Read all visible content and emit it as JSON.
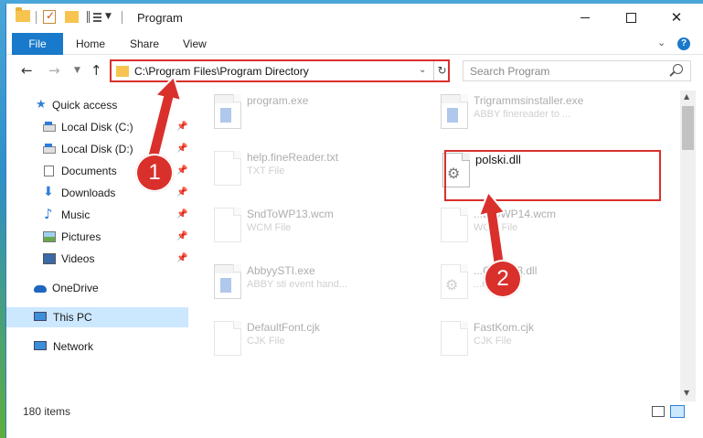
{
  "window": {
    "title": "Program",
    "controls": {
      "minimize": "",
      "maximize": "",
      "close": "✕"
    }
  },
  "ribbon": {
    "tabs": [
      "File",
      "Home",
      "Share",
      "View"
    ],
    "help": "?"
  },
  "address": {
    "path": "C:\\Program Files\\Program Directory"
  },
  "search": {
    "placeholder": "Search Program"
  },
  "sidebar": {
    "items": [
      {
        "label": "Quick access",
        "icon": "star-icon"
      },
      {
        "label": "Local Disk (C:)",
        "icon": "disk-icon",
        "pinned": true
      },
      {
        "label": "Local Disk (D:)",
        "icon": "disk-icon",
        "pinned": true
      },
      {
        "label": "Documents",
        "icon": "documents-icon",
        "pinned": true
      },
      {
        "label": "Downloads",
        "icon": "download-icon",
        "pinned": true
      },
      {
        "label": "Music",
        "icon": "music-icon",
        "pinned": true
      },
      {
        "label": "Pictures",
        "icon": "pictures-icon",
        "pinned": true
      },
      {
        "label": "Videos",
        "icon": "videos-icon",
        "pinned": true
      },
      {
        "label": "OneDrive",
        "icon": "onedrive-icon"
      },
      {
        "label": "This PC",
        "icon": "computer-icon",
        "selected": true
      },
      {
        "label": "Network",
        "icon": "network-icon"
      }
    ]
  },
  "files": [
    {
      "name": "program.exe",
      "type": "",
      "icon": "exe"
    },
    {
      "name": "Trigrammsinstaller.exe",
      "type": "ABBY finereader to ...",
      "icon": "exe"
    },
    {
      "name": "help.fineReader.txt",
      "type": "TXT File",
      "icon": "doc"
    },
    {
      "name": "polski.dll",
      "type": "",
      "icon": "dll",
      "highlighted": true
    },
    {
      "name": "SndToWP13.wcm",
      "type": "WCM File",
      "icon": "doc"
    },
    {
      "name": "...dToWP14.wcm",
      "type": "WCM File",
      "icon": "doc"
    },
    {
      "name": "AbbyySTI.exe",
      "type": "ABBY sti event hand...",
      "icon": "exe"
    },
    {
      "name": "...Client63.dll",
      "type": "...n DLL",
      "icon": "dll"
    },
    {
      "name": "DefaultFont.cjk",
      "type": "CJK File",
      "icon": "doc"
    },
    {
      "name": "FastKom.cjk",
      "type": "CJK File",
      "icon": "doc"
    }
  ],
  "status": {
    "count": "180 items"
  },
  "annotations": {
    "step1": "1",
    "step2": "2",
    "color": "#d9302c"
  }
}
